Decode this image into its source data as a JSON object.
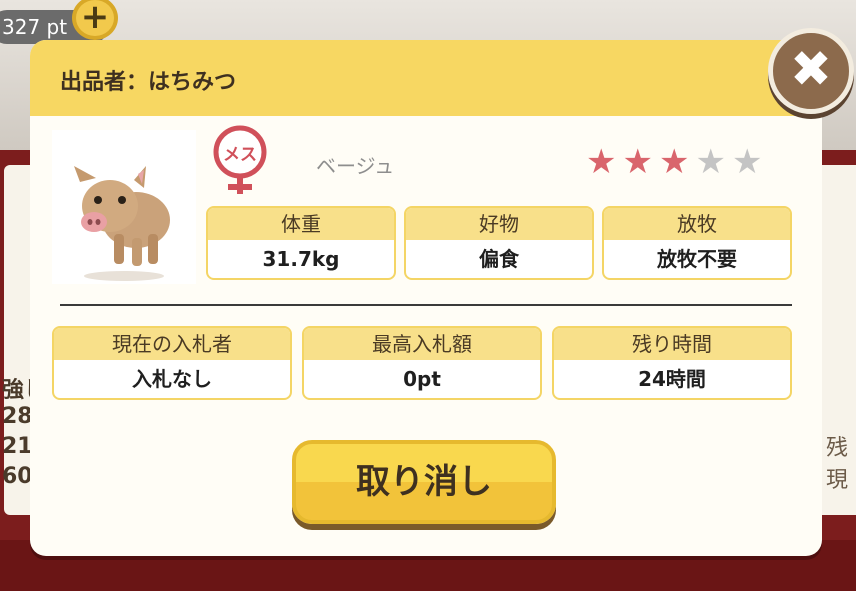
{
  "background": {
    "points_label": "327 pt",
    "left_fragments": [
      "強し",
      "28",
      "21",
      "60"
    ],
    "right_fragments": [
      "残",
      "現"
    ]
  },
  "dialog": {
    "seller_title": "出品者：はちみつ",
    "gender_label": "メス",
    "pig_name": "ベージュ",
    "rating": {
      "filled": 3,
      "total": 5
    },
    "stats": [
      {
        "label": "体重",
        "value": "31.7kg"
      },
      {
        "label": "好物",
        "value": "偏食"
      },
      {
        "label": "放牧",
        "value": "放牧不要"
      }
    ],
    "bid_info": [
      {
        "label": "現在の入札者",
        "value": "入札なし"
      },
      {
        "label": "最高入札額",
        "value": "0pt"
      },
      {
        "label": "残り時間",
        "value": "24時間"
      }
    ],
    "cancel_label": "取り消し"
  },
  "colors": {
    "header_yellow": "#f7d762",
    "accent_pink": "#d9656c",
    "star_empty": "#c4c4c4",
    "close_brown": "#8c6a4c"
  },
  "icons": {
    "close": "close-icon",
    "add_points": "plus-icon",
    "gender": "female-icon",
    "star": "star-icon"
  }
}
